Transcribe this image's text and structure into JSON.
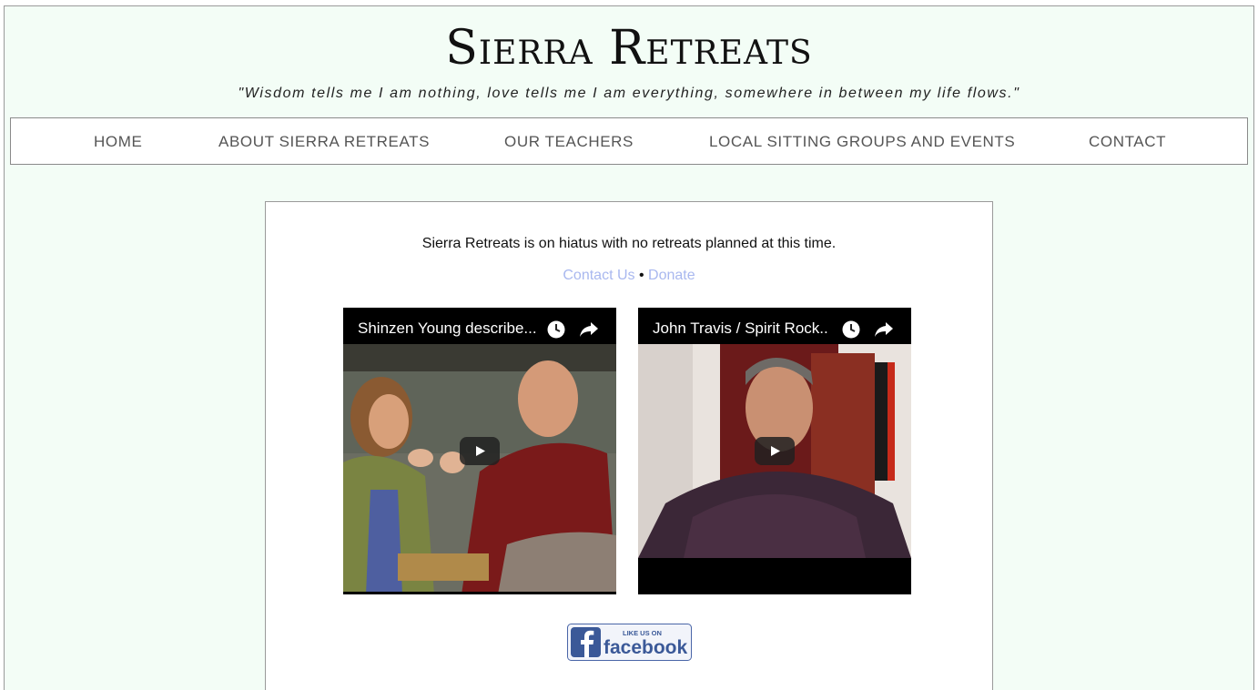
{
  "site": {
    "title": "Sierra Retreats",
    "tagline": "\"Wisdom tells me I am nothing, love tells me I am everything, somewhere in between my life flows.\""
  },
  "nav": {
    "items": [
      {
        "label": "HOME"
      },
      {
        "label": "ABOUT SIERRA RETREATS"
      },
      {
        "label": "OUR TEACHERS"
      },
      {
        "label": "LOCAL SITTING GROUPS AND EVENTS"
      },
      {
        "label": "CONTACT"
      }
    ]
  },
  "main": {
    "notice": "Sierra Retreats is on hiatus with no retreats planned at this time.",
    "contact_label": "Contact Us",
    "separator": "•",
    "donate_label": "Donate",
    "videos": [
      {
        "title": "Shinzen Young describe..."
      },
      {
        "title": "John Travis / Spirit Rock.."
      }
    ],
    "facebook": {
      "small_text": "LIKE US ON",
      "brand": "facebook"
    }
  },
  "colors": {
    "background": "#f3fdf6",
    "link": "#a9b8ef",
    "nav_text": "#555555",
    "facebook_blue": "#3b5998"
  },
  "icons": [
    "clock-icon",
    "share-icon",
    "play-icon",
    "facebook-logo-icon"
  ]
}
